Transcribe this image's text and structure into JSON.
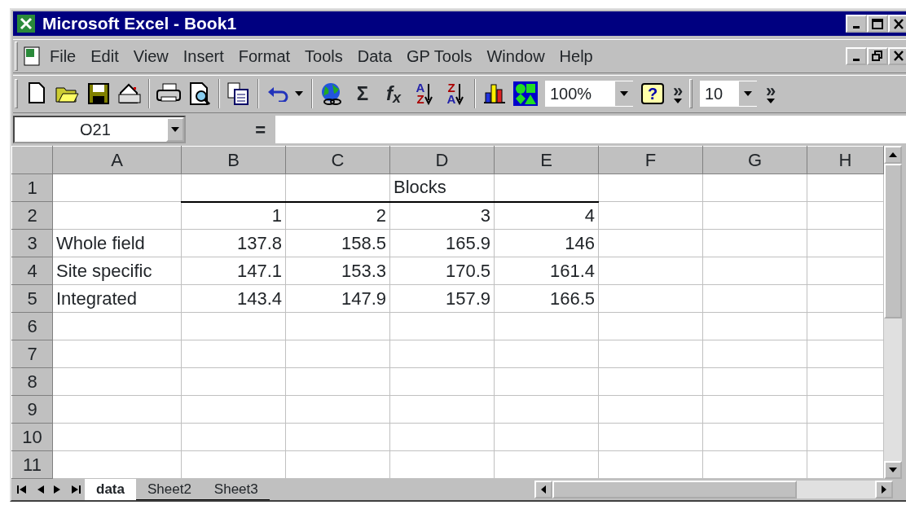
{
  "window": {
    "title": "Microsoft Excel - Book1"
  },
  "menu": [
    "File",
    "Edit",
    "View",
    "Insert",
    "Format",
    "Tools",
    "Data",
    "GP Tools",
    "Window",
    "Help"
  ],
  "toolbar": [
    {
      "kind": "new"
    },
    {
      "kind": "open"
    },
    {
      "kind": "save"
    },
    {
      "kind": "mail"
    },
    {
      "kind": "sep"
    },
    {
      "kind": "print"
    },
    {
      "kind": "preview"
    },
    {
      "kind": "sep"
    },
    {
      "kind": "paste"
    },
    {
      "kind": "sep"
    },
    {
      "kind": "undo"
    },
    {
      "kind": "sep"
    },
    {
      "kind": "web"
    },
    {
      "kind": "glyph",
      "label": "Σ"
    },
    {
      "kind": "glyph",
      "label": "f$_{x}$"
    },
    {
      "kind": "sort",
      "top": "A",
      "bottom": "Z"
    },
    {
      "kind": "sort",
      "top": "Z",
      "bottom": "A"
    },
    {
      "kind": "sep"
    },
    {
      "kind": "chart"
    },
    {
      "kind": "map"
    },
    {
      "kind": "combo",
      "value": "100%"
    },
    {
      "kind": "help",
      "label": "?"
    },
    {
      "kind": "more",
      "label": "»"
    },
    {
      "kind": "grip"
    },
    {
      "kind": "combo",
      "value": "10"
    },
    {
      "kind": "more",
      "label": "»"
    }
  ],
  "formula_bar": {
    "name_box": "O21",
    "equals": "="
  },
  "columns": [
    "A",
    "B",
    "C",
    "D",
    "E",
    "F",
    "G",
    "H"
  ],
  "rows": [
    {
      "header": "1",
      "cells": [
        "",
        "",
        "",
        "Blocks",
        "",
        "",
        "",
        ""
      ]
    },
    {
      "header": "2",
      "cells": [
        "",
        "1",
        "2",
        "3",
        "4",
        "",
        "",
        ""
      ]
    },
    {
      "header": "3",
      "cells": [
        "Whole field",
        "137.8",
        "158.5",
        "165.9",
        "146",
        "",
        "",
        ""
      ]
    },
    {
      "header": "4",
      "cells": [
        "Site specific",
        "147.1",
        "153.3",
        "170.5",
        "161.4",
        "",
        "",
        ""
      ]
    },
    {
      "header": "5",
      "cells": [
        "Integrated",
        "143.4",
        "147.9",
        "157.9",
        "166.5",
        "",
        "",
        ""
      ]
    },
    {
      "header": "6",
      "cells": [
        "",
        "",
        "",
        "",
        "",
        "",
        "",
        ""
      ]
    },
    {
      "header": "7",
      "cells": [
        "",
        "",
        "",
        "",
        "",
        "",
        "",
        ""
      ]
    },
    {
      "header": "8",
      "cells": [
        "",
        "",
        "",
        "",
        "",
        "",
        "",
        ""
      ]
    },
    {
      "header": "9",
      "cells": [
        "",
        "",
        "",
        "",
        "",
        "",
        "",
        ""
      ]
    },
    {
      "header": "10",
      "cells": [
        "",
        "",
        "",
        "",
        "",
        "",
        "",
        ""
      ]
    },
    {
      "header": "11",
      "cells": [
        "",
        "",
        "",
        "",
        "",
        "",
        "",
        ""
      ]
    }
  ],
  "sheet_tabs": [
    {
      "label": "data",
      "selected": true
    },
    {
      "label": "Sheet2",
      "selected": false
    },
    {
      "label": "Sheet3",
      "selected": false
    }
  ]
}
